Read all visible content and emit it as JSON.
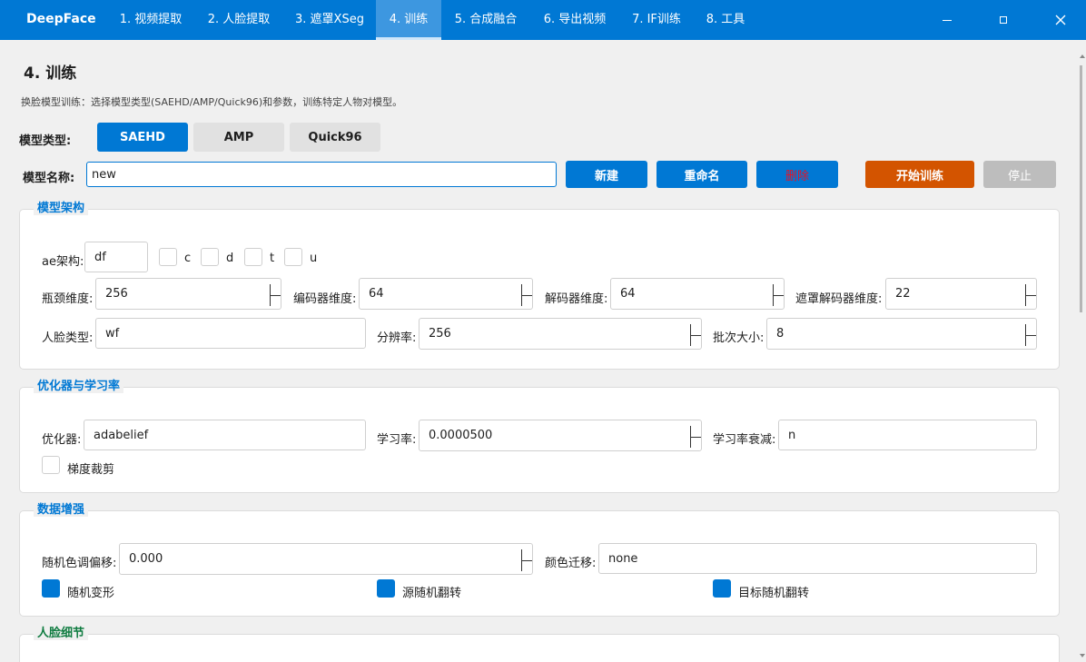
{
  "app": {
    "title": "DeepFace"
  },
  "tabs": [
    {
      "label": "1. 视频提取"
    },
    {
      "label": "2. 人脸提取"
    },
    {
      "label": "3. 遮罩XSeg"
    },
    {
      "label": "4. 训练"
    },
    {
      "label": "5. 合成融合"
    },
    {
      "label": "6. 导出视频"
    },
    {
      "label": "7. IF训练"
    },
    {
      "label": "8. 工具"
    }
  ],
  "page": {
    "title": "4. 训练",
    "description": "换脸模型训练：选择模型类型(SAEHD/AMP/Quick96)和参数，训练特定人物对模型。"
  },
  "model_type": {
    "label": "模型类型:",
    "options": [
      "SAEHD",
      "AMP",
      "Quick96"
    ],
    "selected": "SAEHD"
  },
  "model_name": {
    "label": "模型名称:",
    "value": "new",
    "new_label": "新建",
    "rename_label": "重命名",
    "delete_label": "删除",
    "start_label": "开始训练",
    "stop_label": "停止"
  },
  "architecture": {
    "title": "模型架构",
    "ae_label": "ae架构:",
    "ae_value": "df",
    "flags": [
      {
        "label": "c",
        "checked": false
      },
      {
        "label": "d",
        "checked": false
      },
      {
        "label": "t",
        "checked": false
      },
      {
        "label": "u",
        "checked": false
      }
    ],
    "bottleneck_label": "瓶颈维度:",
    "bottleneck_value": "256",
    "encoder_label": "编码器维度:",
    "encoder_value": "64",
    "decoder_label": "解码器维度:",
    "decoder_value": "64",
    "mask_decoder_label": "遮罩解码器维度:",
    "mask_decoder_value": "22",
    "face_type_label": "人脸类型:",
    "face_type_value": "wf",
    "resolution_label": "分辨率:",
    "resolution_value": "256",
    "batch_label": "批次大小:",
    "batch_value": "8"
  },
  "optimizer": {
    "title": "优化器与学习率",
    "optimizer_label": "优化器:",
    "optimizer_value": "adabelief",
    "lr_label": "学习率:",
    "lr_value": "0.0000500",
    "lr_decay_label": "学习率衰减:",
    "lr_decay_value": "n",
    "clip_label": "梯度裁剪",
    "clip_checked": false
  },
  "augmentation": {
    "title": "数据增强",
    "hue_label": "随机色调偏移:",
    "hue_value": "0.000",
    "color_transfer_label": "颜色迁移:",
    "color_transfer_value": "none",
    "random_warp_label": "随机变形",
    "random_warp_checked": true,
    "src_flip_label": "源随机翻转",
    "src_flip_checked": true,
    "dst_flip_label": "目标随机翻转",
    "dst_flip_checked": true
  },
  "face_detail": {
    "title": "人脸细节"
  }
}
